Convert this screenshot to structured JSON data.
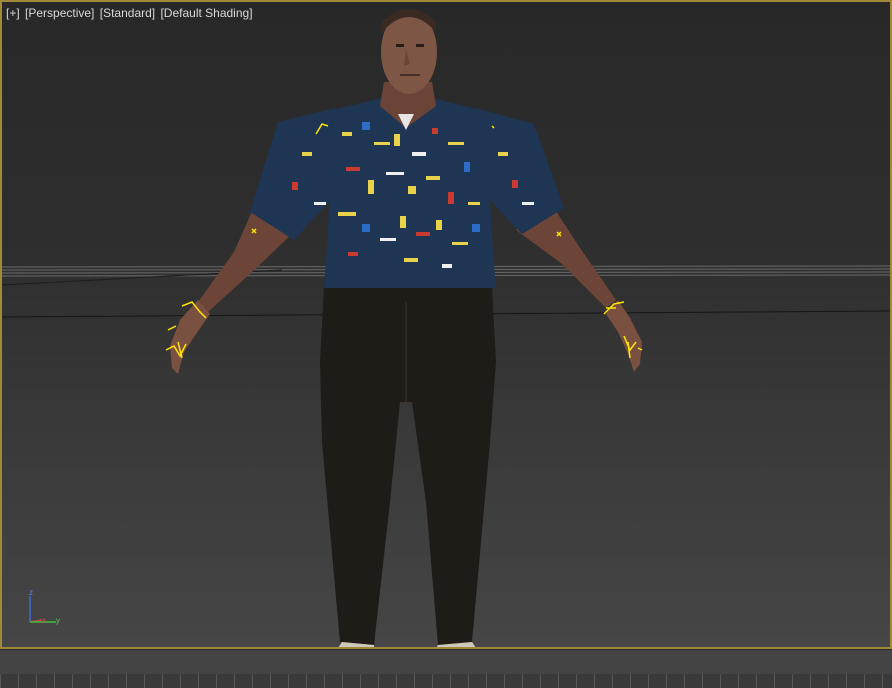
{
  "viewport": {
    "labels": [
      "[+]",
      "[Perspective]",
      "[Standard]",
      "[Default Shading]"
    ],
    "view_mode": "Perspective"
  },
  "gizmo": {
    "z": "z",
    "x": "x",
    "y": "y"
  },
  "colors": {
    "viewport_border": "#a08a3a",
    "bone_markers": "#ffe600",
    "shirt": "#1e3553",
    "pants": "#1f1b17",
    "skin": "#7a5040"
  },
  "icons": [
    "axis-gizmo-icon",
    "bone-marker-icon"
  ]
}
